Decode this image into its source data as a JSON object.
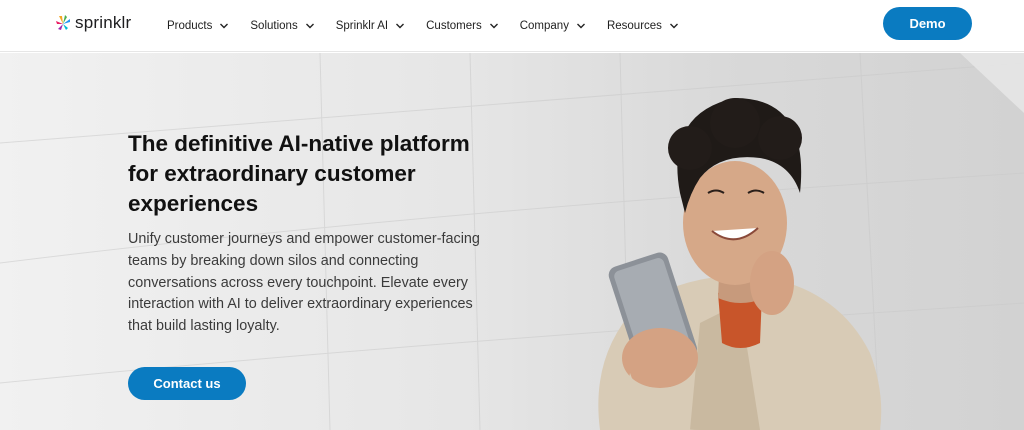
{
  "header": {
    "logo_text": "sprinklr",
    "nav": [
      {
        "label": "Products",
        "icon": "chevron-down-icon"
      },
      {
        "label": "Solutions",
        "icon": "chevron-down-icon"
      },
      {
        "label": "Sprinklr AI",
        "icon": "chevron-down-icon"
      },
      {
        "label": "Customers",
        "icon": "chevron-down-icon"
      },
      {
        "label": "Company",
        "icon": "chevron-down-icon"
      },
      {
        "label": "Resources",
        "icon": "chevron-down-icon"
      }
    ],
    "demo_label": "Demo"
  },
  "hero": {
    "headline": "The definitive AI-native platform for extraordinary customer experiences",
    "body": "Unify customer journeys and empower customer-facing teams by breaking down silos and connecting conversations across every touchpoint. Elevate every interaction with AI to deliver extraordinary experiences that build lasting loyalty.",
    "cta_label": "Contact us"
  },
  "colors": {
    "accent": "#0a7bc1",
    "headline": "#111111",
    "body_text": "#3b3b3b"
  }
}
